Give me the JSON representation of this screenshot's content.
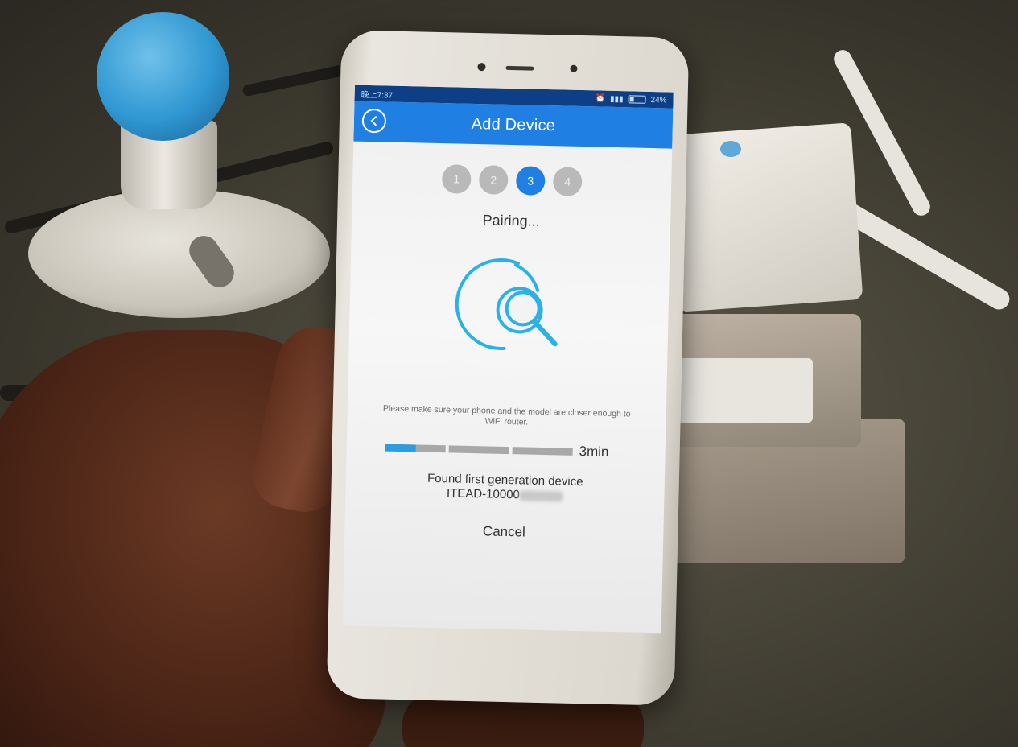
{
  "status_bar": {
    "time": "晚上7:37",
    "battery": "24%"
  },
  "header": {
    "title": "Add Device",
    "back_icon": "chevron-left-icon"
  },
  "steps": {
    "items": [
      "1",
      "2",
      "3",
      "4"
    ],
    "current": 3
  },
  "pairing": {
    "status": "Pairing...",
    "illustration_icon": "search-device-icon",
    "hint": "Please make sure your phone and the model are closer enough to WiFi router.",
    "progress_fraction": 0.17,
    "timer": "3min",
    "found_text": "Found first generation device",
    "device_id": "ITEAD-10000"
  },
  "actions": {
    "cancel_label": "Cancel"
  },
  "colors": {
    "primary": "#1f7fe2",
    "progress": "#2a9ee0",
    "inactive_step": "#b9b9b9"
  }
}
